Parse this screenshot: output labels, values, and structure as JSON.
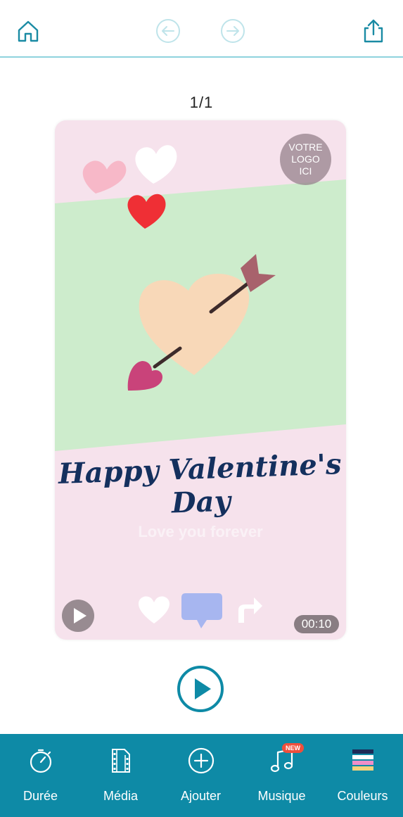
{
  "header": {
    "page_counter": "1/1"
  },
  "card": {
    "logo_lines": [
      "VOTRE",
      "LOGO",
      "ICI"
    ],
    "headline": "Happy Valentine's Day",
    "subline": "Love you forever",
    "duration": "00:10"
  },
  "toolbar": {
    "items": [
      {
        "label": "Durée"
      },
      {
        "label": "Média"
      },
      {
        "label": "Ajouter"
      },
      {
        "label": "Musique",
        "badge": "NEW"
      },
      {
        "label": "Couleurs"
      }
    ]
  },
  "colors": {
    "accent": "#0e8aa6",
    "divider": "#8fd3dd",
    "card_bg": "#f6e2ec",
    "card_band": "#cdeccc",
    "headline": "#14305e"
  }
}
